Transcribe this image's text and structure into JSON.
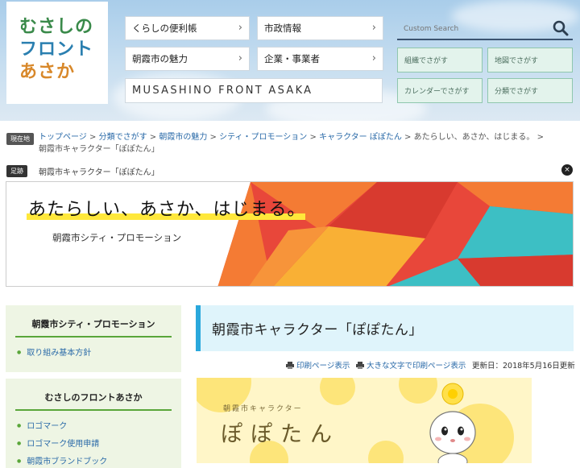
{
  "header": {
    "logo_lines": [
      "むさしの",
      "フロント",
      "あさか"
    ],
    "nav": [
      {
        "label": "くらしの便利帳"
      },
      {
        "label": "市政情報"
      },
      {
        "label": "朝霞市の魅力"
      },
      {
        "label": "企業・事業者"
      }
    ],
    "musashino_label": "MUSASHINO FRONT ASAKA",
    "search": {
      "placeholder": "Custom Search",
      "icon": "search-icon"
    },
    "finders": [
      {
        "label": "組織でさがす"
      },
      {
        "label": "地図でさがす"
      },
      {
        "label": "カレンダーでさがす"
      },
      {
        "label": "分類でさがす"
      }
    ],
    "chevron": "›"
  },
  "breadcrumb": {
    "tag": "現在地",
    "items": [
      "トップページ",
      "分類でさがす",
      "朝霞市の魅力",
      "シティ・プロモーション",
      "キャラクター ぽぽたん",
      "あたらしい、あさか、はじまる。"
    ],
    "separator": ">",
    "current": "朝霞市キャラクター「ぽぽたん」"
  },
  "footprint": {
    "tag": "足跡",
    "text": "朝霞市キャラクター「ぽぽたん」",
    "close": "×"
  },
  "banner": {
    "title": "あたらしい、あさか、はじまる。",
    "subtitle": "朝霞市シティ・プロモーション",
    "colors": [
      "#e8473a",
      "#f47b34",
      "#f9b035",
      "#3dbfc4",
      "#d83a2f"
    ]
  },
  "side_menus": [
    {
      "title": "朝霞市シティ・プロモーション",
      "items": [
        "取り組み基本方針"
      ]
    },
    {
      "title": "むさしのフロントあさか",
      "items": [
        "ロゴマーク",
        "ロゴマーク使用申請",
        "朝霞市ブランドブック"
      ]
    }
  ],
  "main": {
    "title": "朝霞市キャラクター「ぽぽたん」",
    "print_label": "印刷ページ表示",
    "large_print_label": "大きな文字で印刷ページ表示",
    "updated_label": "更新日：2018年5月16日更新",
    "character": {
      "subtitle": "朝霞市キャラクター",
      "name": "ぽぽたん"
    }
  },
  "colors": {
    "accent_green": "#5aa63a",
    "accent_blue": "#2aa8dc",
    "link": "#2a6aa8"
  }
}
